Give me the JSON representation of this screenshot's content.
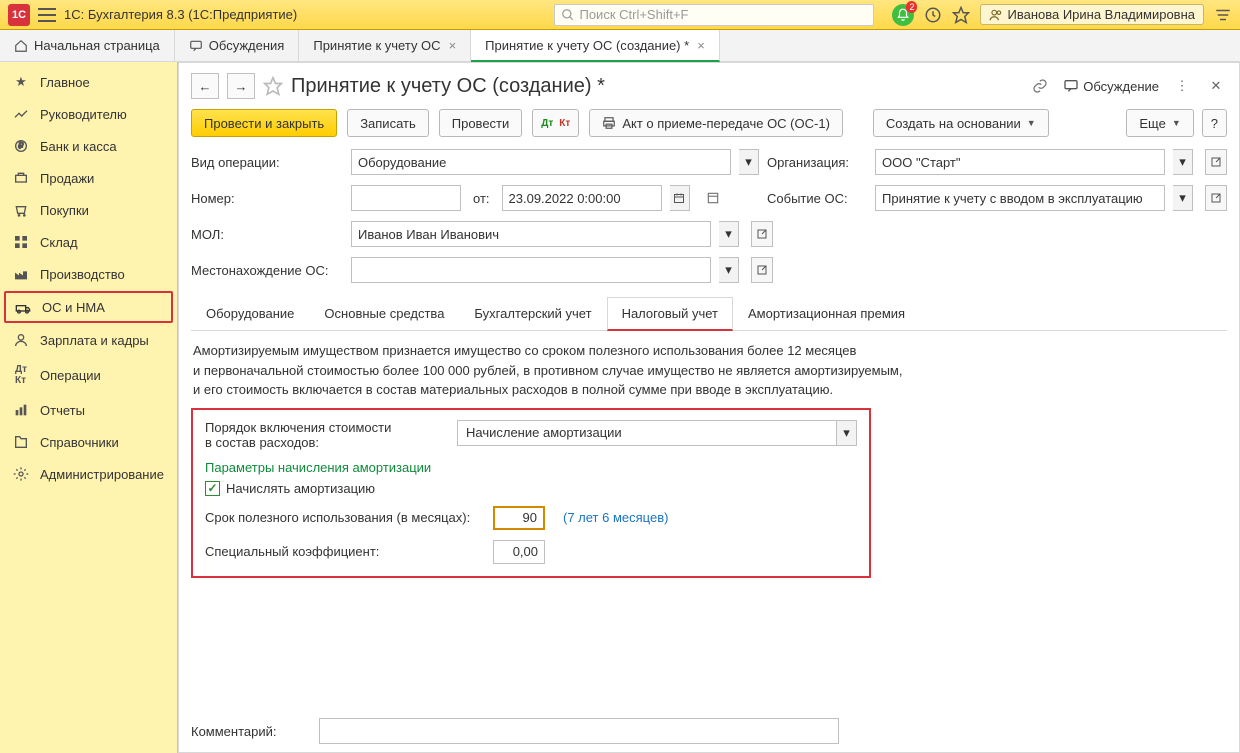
{
  "app": {
    "title": "1С: Бухгалтерия 8.3  (1С:Предприятие)",
    "search_placeholder": "Поиск Ctrl+Shift+F",
    "bell_badge": "2",
    "user_name": "Иванова Ирина Владимировна"
  },
  "main_tabs": {
    "home": "Начальная страница",
    "t1": "Обсуждения",
    "t2": "Принятие к учету ОС",
    "t3": "Принятие к учету ОС (создание) *"
  },
  "sidebar": {
    "items": [
      "Главное",
      "Руководителю",
      "Банк и касса",
      "Продажи",
      "Покупки",
      "Склад",
      "Производство",
      "ОС и НМА",
      "Зарплата и кадры",
      "Операции",
      "Отчеты",
      "Справочники",
      "Администрирование"
    ]
  },
  "form": {
    "title": "Принятие к учету ОС (создание) *",
    "discuss": "Обсуждение",
    "buttons": {
      "post_close": "Провести и закрыть",
      "save": "Записать",
      "post": "Провести",
      "print": "Акт о приеме-передаче ОС (ОС-1)",
      "create_based": "Создать на основании",
      "more": "Еще"
    },
    "labels": {
      "op_type": "Вид операции:",
      "number": "Номер:",
      "from": "от:",
      "mol": "МОЛ:",
      "location": "Местонахождение ОС:",
      "org": "Организация:",
      "event": "Событие ОС:",
      "comment": "Комментарий:"
    },
    "values": {
      "op_type": "Оборудование",
      "number": "",
      "date": "23.09.2022  0:00:00",
      "mol": "Иванов Иван Иванович",
      "location": "",
      "org": "ООО \"Старт\"",
      "event": "Принятие к учету с вводом в эксплуатацию",
      "comment": ""
    },
    "subtabs": {
      "t0": "Оборудование",
      "t1": "Основные средства",
      "t2": "Бухгалтерский учет",
      "t3": "Налоговый учет",
      "t4": "Амортизационная премия"
    },
    "help": {
      "l1": "Амортизируемым имуществом признается имущество со сроком полезного использования более 12 месяцев",
      "l2": "и первоначальной стоимостью более 100 000 рублей, в противном случае имущество не является амортизируемым,",
      "l3": "и его стоимость включается в состав материальных расходов в полной сумме при вводе в эксплуатацию."
    },
    "tax": {
      "include_label_1": "Порядок включения стоимости",
      "include_label_2": "в состав расходов:",
      "include_value": "Начисление амортизации",
      "params_head": "Параметры начисления амортизации",
      "chk_label": "Начислять амортизацию",
      "life_label": "Срок полезного использования (в месяцах):",
      "life_value": "90",
      "life_hint": "(7 лет 6 месяцев)",
      "coef_label": "Специальный коэффициент:",
      "coef_value": "0,00"
    }
  }
}
